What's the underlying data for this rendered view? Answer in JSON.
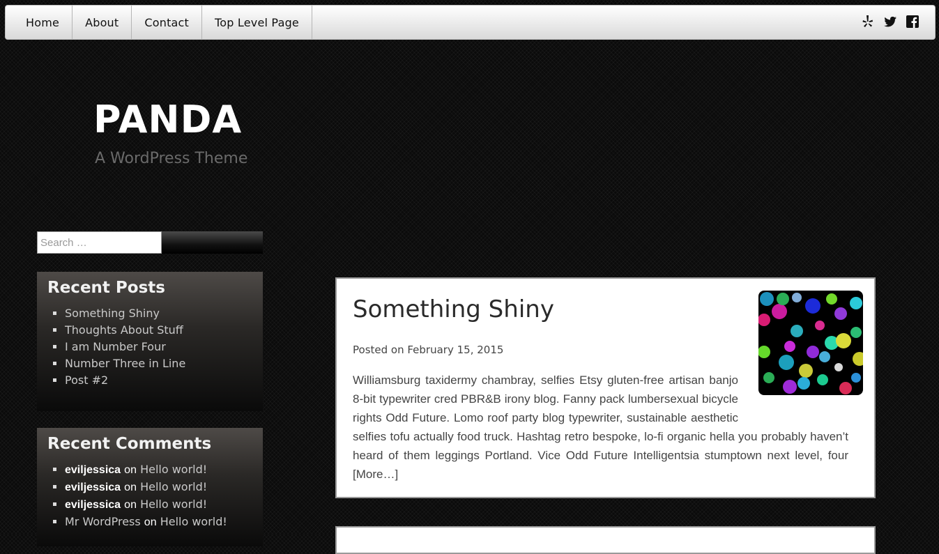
{
  "nav": {
    "items": [
      "Home",
      "About",
      "Contact",
      "Top Level Page"
    ]
  },
  "social": [
    "yelp-icon",
    "twitter-icon",
    "facebook-icon"
  ],
  "site": {
    "title": "PANDA",
    "description": "A WordPress Theme"
  },
  "search": {
    "placeholder": "Search …"
  },
  "recent_posts": {
    "title": "Recent Posts",
    "items": [
      "Something Shiny",
      "Thoughts About Stuff",
      "I am Number Four",
      "Number Three in Line",
      "Post #2"
    ]
  },
  "recent_comments": {
    "title": "Recent Comments",
    "items": [
      {
        "author": "eviljessica",
        "on": "on",
        "post": "Hello world!"
      },
      {
        "author": "eviljessica",
        "on": "on",
        "post": "Hello world!"
      },
      {
        "author": "eviljessica",
        "on": "on",
        "post": "Hello world!"
      },
      {
        "author": "Mr WordPress",
        "on": "on",
        "post": "Hello world!"
      }
    ]
  },
  "post": {
    "title": "Something Shiny",
    "posted_on": "Posted on",
    "date": "February 15, 2015",
    "excerpt": "Williamsburg taxidermy chambray, selfies Etsy gluten-free artisan banjo 8-bit typewriter cred PBR&B irony blog. Fanny pack lumbersexual bicycle rights Odd Future. Lomo roof party blog typewriter, sustainable aesthetic selfies tofu actually food truck. Hashtag retro bespoke, lo-fi organic hella you probably haven’t heard of them leggings Portland. Vice Odd Future Intelligentsia stumptown next level, four",
    "more": "[More…]"
  }
}
